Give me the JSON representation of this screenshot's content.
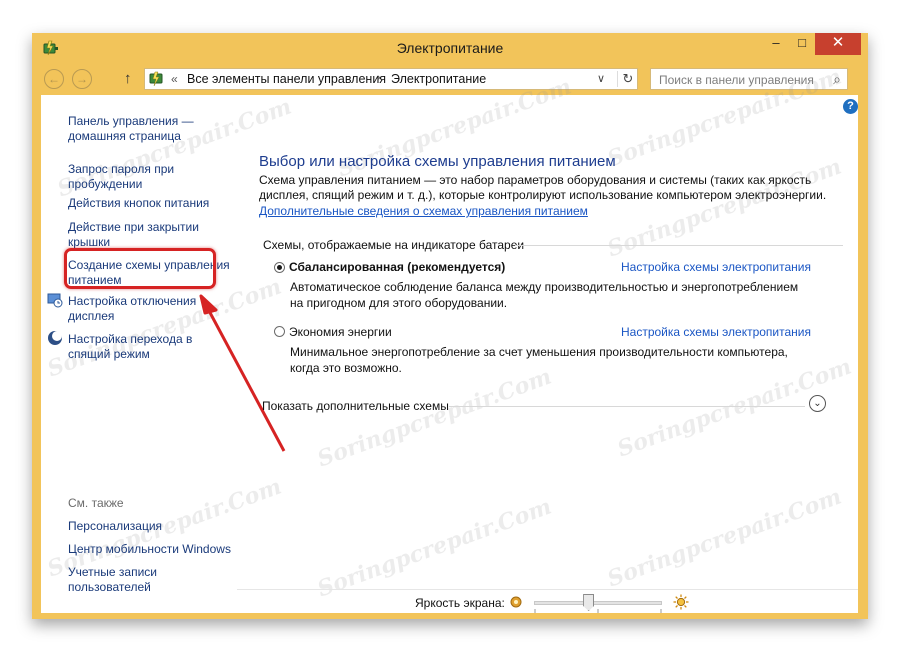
{
  "window": {
    "title": "Электропитание",
    "controls": {
      "minimize": "–",
      "maximize": "□",
      "close": "✕"
    }
  },
  "navigation": {
    "back": "←",
    "forward": "→",
    "up": "↑",
    "breadcrumb_chevron": "«",
    "breadcrumb": [
      "Все элементы панели управления",
      "Электропитание"
    ],
    "separator": "›",
    "dropdown": "∨",
    "refresh": "↻"
  },
  "search": {
    "placeholder": "Поиск в панели управления",
    "icon": "⌕"
  },
  "help": {
    "icon": "?"
  },
  "sidebar": {
    "links": [
      {
        "label": "Панель управления — домашняя страница"
      },
      {
        "label": "Запрос пароля при пробуждении"
      },
      {
        "label": "Действия кнопок питания"
      },
      {
        "label": "Действие при закрытии крышки"
      },
      {
        "label": "Создание схемы управления питанием"
      },
      {
        "label": "Настройка отключения дисплея"
      },
      {
        "label": "Настройка перехода в спящий режим"
      }
    ],
    "see_also_heading": "См. также",
    "see_also": [
      {
        "label": "Персонализация"
      },
      {
        "label": "Центр мобильности Windows"
      },
      {
        "label": "Учетные записи пользователей"
      }
    ]
  },
  "main": {
    "title": "Выбор или настройка схемы управления питанием",
    "description": "Схема управления питанием — это набор параметров оборудования и системы (таких как яркость дисплея, спящий режим и т. д.), которые контролируют использование компьютером электроэнергии.",
    "more_info_link": "Дополнительные сведения о схемах управления питанием",
    "plans_group_label": "Схемы, отображаемые на индикаторе батареи",
    "plans": [
      {
        "name": "Сбалансированная (рекомендуется)",
        "selected": true,
        "description": "Автоматическое соблюдение баланса между производительностью и энергопотреблением на пригодном для этого оборудовании.",
        "settings_link": "Настройка схемы электропитания"
      },
      {
        "name": "Экономия энергии",
        "selected": false,
        "description": "Минимальное энергопотребление за счет уменьшения производительности компьютера, когда это возможно.",
        "settings_link": "Настройка схемы электропитания"
      }
    ],
    "show_more_label": "Показать дополнительные схемы",
    "show_more_icon": "⌄"
  },
  "bottom": {
    "brightness_label": "Яркость экрана:",
    "brightness_level": 0.42
  },
  "watermark": "Soringpcrepair.Com",
  "colors": {
    "title_bar": "#f2c45a",
    "close_button": "#c7402e",
    "link": "#1a56c4",
    "heading": "#1e3d8f",
    "highlight": "#d62323"
  }
}
